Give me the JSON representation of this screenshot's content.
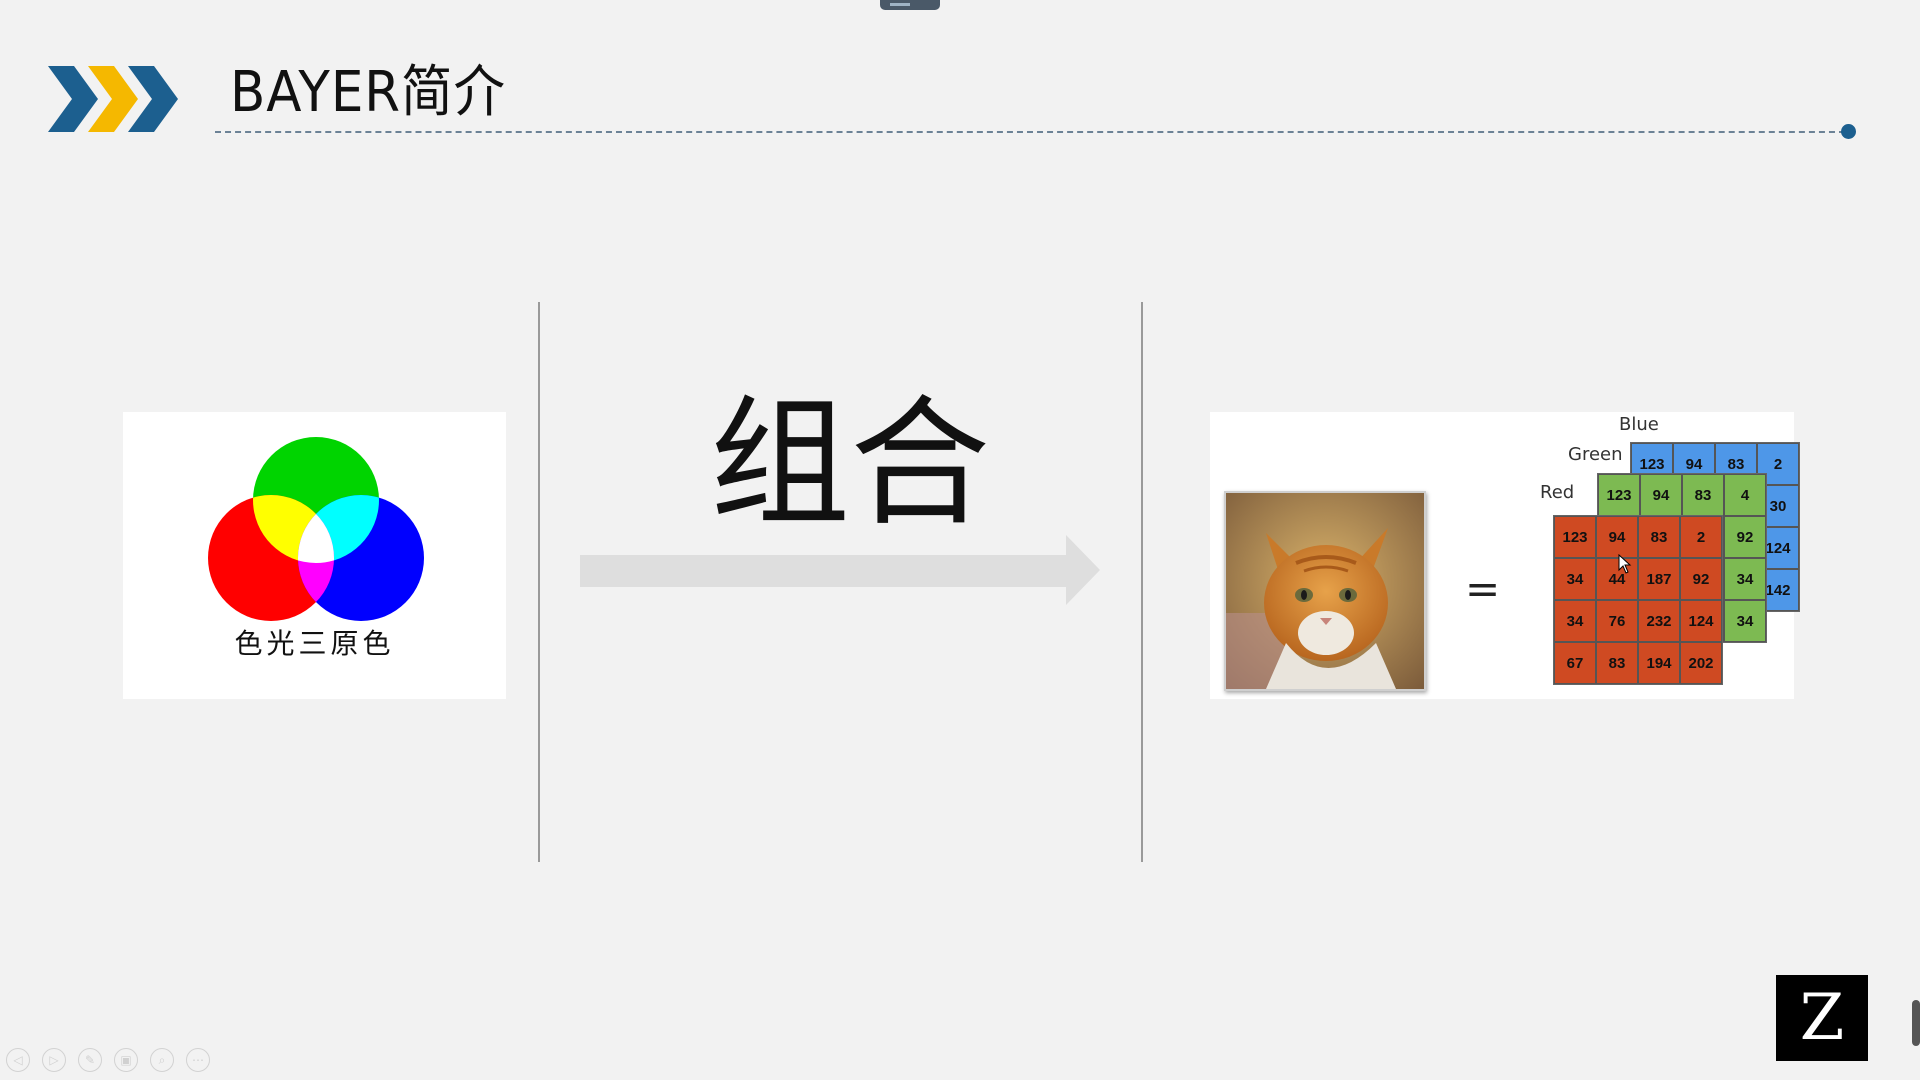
{
  "slide": {
    "title": "BAYER简介",
    "combine_text": "组合",
    "rgb_label": "色光三原色",
    "equals": "=",
    "logo_letter": "Z"
  },
  "channels": {
    "blue": {
      "label": "Blue",
      "rows": [
        [
          "123",
          "94",
          "83",
          "2"
        ],
        [
          "",
          "",
          "",
          "30"
        ],
        [
          "",
          "",
          "",
          "124"
        ],
        [
          "",
          "",
          "",
          "142"
        ]
      ]
    },
    "green": {
      "label": "Green",
      "rows": [
        [
          "123",
          "94",
          "83",
          "4"
        ],
        [
          "",
          "",
          "",
          "92"
        ],
        [
          "",
          "",
          "",
          "34"
        ],
        [
          "",
          "",
          "",
          "34"
        ]
      ]
    },
    "red": {
      "label": "Red",
      "rows": [
        [
          "123",
          "94",
          "83",
          "2"
        ],
        [
          "34",
          "44",
          "187",
          "92"
        ],
        [
          "34",
          "76",
          "232",
          "124"
        ],
        [
          "67",
          "83",
          "194",
          "202"
        ]
      ]
    }
  },
  "colors": {
    "accent_blue": "#1c5f8f",
    "accent_yellow": "#f5b800",
    "channel_blue": "#4e97e8",
    "channel_green": "#7dba52",
    "channel_red": "#cf4a22"
  },
  "player_controls": [
    {
      "icon": "prev-icon",
      "glyph": "◁"
    },
    {
      "icon": "next-icon",
      "glyph": "▷"
    },
    {
      "icon": "pen-icon",
      "glyph": "✎"
    },
    {
      "icon": "slides-icon",
      "glyph": "▣"
    },
    {
      "icon": "zoom-icon",
      "glyph": "⌕"
    },
    {
      "icon": "more-icon",
      "glyph": "⋯"
    }
  ]
}
